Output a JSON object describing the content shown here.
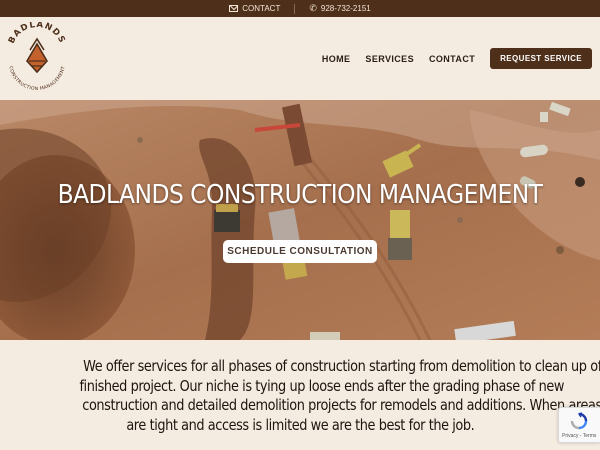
{
  "topbar": {
    "contact_label": "CONTACT",
    "phone": "928-732-2151"
  },
  "header": {
    "logo": {
      "name": "BADLANDS",
      "tagline": "CONSTRUCTION MANAGEMENT"
    },
    "nav": [
      "HOME",
      "SERVICES",
      "CONTACT"
    ],
    "cta_label": "REQUEST SERVICE"
  },
  "hero": {
    "title": "BADLANDS CONSTRUCTION MANAGEMENT",
    "button_label": "SCHEDULE CONSULTATION"
  },
  "intro": {
    "lines": [
      "We offer services for all phases of construction starting from demolition to clean up of a",
      "finished project. Our niche is tying up loose ends after the grading phase of new",
      "construction and detailed demolition projects for remodels and additions. When areas",
      "are tight and access is limited we are the best for the job."
    ]
  },
  "recaptcha": {
    "links": "Privacy - Terms"
  },
  "colors": {
    "brand_brown": "#4e2f1a",
    "background": "#f5ece1",
    "accent_orange": "#c4622d"
  }
}
